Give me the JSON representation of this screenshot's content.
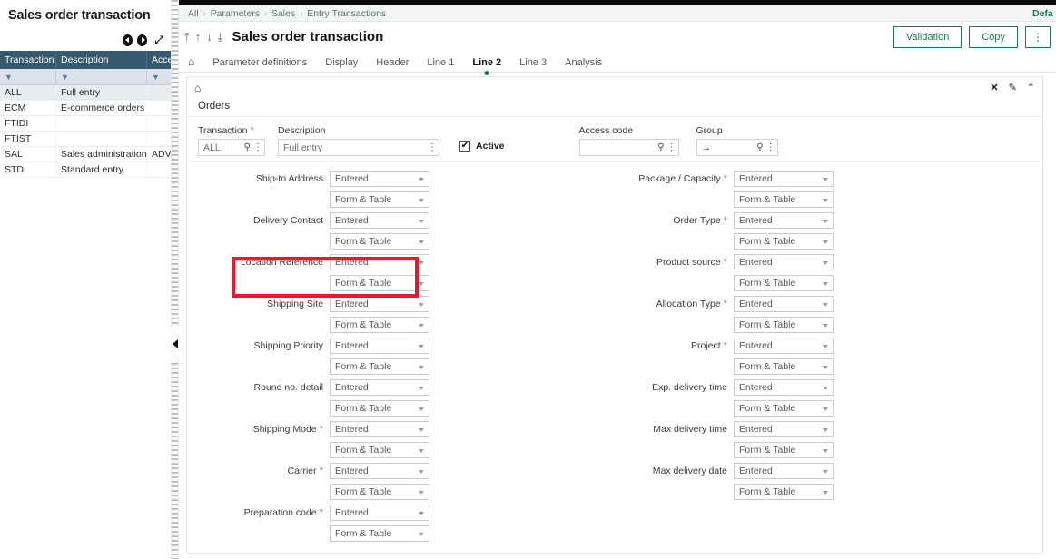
{
  "sidebar": {
    "title": "Sales order transaction",
    "tools": {
      "prev": "previous-page",
      "next": "next-page",
      "expand": "⤢"
    },
    "columns": [
      "Transaction",
      "Description",
      "Acce"
    ],
    "filter_icon": "▼",
    "rows": [
      {
        "transaction": "ALL",
        "description": "Full entry",
        "access": "",
        "selected": true
      },
      {
        "transaction": "ECM",
        "description": "E-commerce orders",
        "access": "",
        "selected": false
      },
      {
        "transaction": "FTIDI",
        "description": "",
        "access": "",
        "selected": false
      },
      {
        "transaction": "FTIST",
        "description": "",
        "access": "",
        "selected": false
      },
      {
        "transaction": "SAL",
        "description": "Sales administration",
        "access": "ADV",
        "selected": false
      },
      {
        "transaction": "STD",
        "description": "Standard entry",
        "access": "",
        "selected": false
      }
    ]
  },
  "breadcrumb": {
    "items": [
      "All",
      "Parameters",
      "Sales",
      "Entry Transactions"
    ],
    "separator": "›",
    "right_link": "Defa"
  },
  "titlebar": {
    "nav": [
      "⤒",
      "↑",
      "↓",
      "⤓"
    ],
    "title": "Sales order transaction",
    "validation_label": "Validation",
    "copy_label": "Copy",
    "kebab_label": "⋮"
  },
  "tabs": {
    "home_icon": "⌂",
    "items": [
      {
        "label": "Parameter definitions",
        "active": false
      },
      {
        "label": "Display",
        "active": false
      },
      {
        "label": "Header",
        "active": false
      },
      {
        "label": "Line 1",
        "active": false
      },
      {
        "label": "Line 2",
        "active": true
      },
      {
        "label": "Line 3",
        "active": false
      },
      {
        "label": "Analysis",
        "active": false
      }
    ]
  },
  "panel": {
    "home_icon": "⌂",
    "icons": {
      "close": "✕",
      "edit": "✎",
      "collapse": "⌃"
    },
    "section_title": "Orders",
    "header_fields": {
      "transaction": {
        "label": "Transaction",
        "required": true,
        "value": "ALL"
      },
      "description": {
        "label": "Description",
        "required": false,
        "value": "Full entry"
      },
      "access_code": {
        "label": "Access code",
        "required": false,
        "value": ""
      },
      "group": {
        "label": "Group",
        "required": false,
        "value": "→"
      }
    },
    "active_checkbox": {
      "label": "Active",
      "checked": true,
      "mark": "✔"
    }
  },
  "form": {
    "option_entered": "Entered",
    "option_form_table": "Form & Table",
    "left_column": [
      {
        "label": "Ship-to Address",
        "required": false,
        "value1": "Entered",
        "value2": "Form & Table",
        "highlighted": true
      },
      {
        "label": "Delivery Contact",
        "required": false,
        "value1": "Entered",
        "value2": "Form & Table",
        "highlighted": false
      },
      {
        "label": "Location Reference",
        "required": false,
        "value1": "Entered",
        "value2": "Form & Table",
        "highlighted": false
      },
      {
        "label": "Shipping Site",
        "required": false,
        "value1": "Entered",
        "value2": "Form & Table",
        "highlighted": false
      },
      {
        "label": "Shipping Priority",
        "required": false,
        "value1": "Entered",
        "value2": "Form & Table",
        "highlighted": false
      },
      {
        "label": "Round no. detail",
        "required": false,
        "value1": "Entered",
        "value2": "Form & Table",
        "highlighted": false
      },
      {
        "label": "Shipping Mode",
        "required": true,
        "value1": "Entered",
        "value2": "Form & Table",
        "highlighted": false
      },
      {
        "label": "Carrier",
        "required": true,
        "value1": "Entered",
        "value2": "Form & Table",
        "highlighted": false
      },
      {
        "label": "Preparation code",
        "required": true,
        "value1": "Entered",
        "value2": "Form & Table",
        "highlighted": false
      }
    ],
    "right_column": [
      {
        "label": "Package / Capacity",
        "required": true,
        "value1": "Entered",
        "value2": "Form & Table"
      },
      {
        "label": "Order Type",
        "required": true,
        "value1": "Entered",
        "value2": "Form & Table"
      },
      {
        "label": "Product source",
        "required": true,
        "value1": "Entered",
        "value2": "Form & Table"
      },
      {
        "label": "Allocation Type",
        "required": true,
        "value1": "Entered",
        "value2": "Form & Table"
      },
      {
        "label": "Project",
        "required": true,
        "value1": "Entered",
        "value2": "Form & Table"
      },
      {
        "label": "Exp. delivery time",
        "required": false,
        "value1": "Entered",
        "value2": "Form & Table"
      },
      {
        "label": "Max delivery time",
        "required": false,
        "value1": "Entered",
        "value2": "Form & Table"
      },
      {
        "label": "Max delivery date",
        "required": false,
        "value1": "Entered",
        "value2": "Form & Table"
      }
    ]
  },
  "colors": {
    "grid_header": "#35596e",
    "accent_green": "#1c7a4d",
    "highlight_red": "#e8192c",
    "required_star": "#c9626f"
  }
}
